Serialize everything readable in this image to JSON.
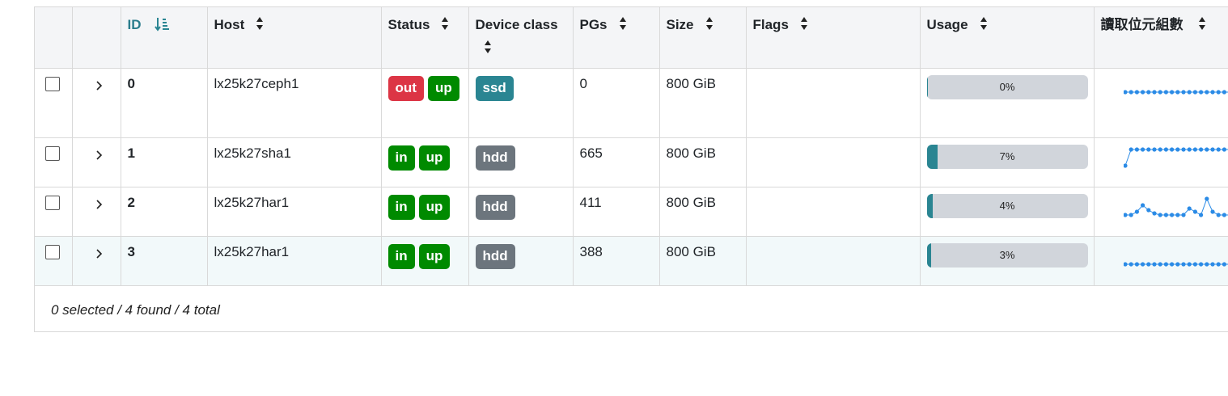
{
  "columns": {
    "id": "ID",
    "host": "Host",
    "status": "Status",
    "device_class": "Device class",
    "pgs": "PGs",
    "size": "Size",
    "flags": "Flags",
    "usage": "Usage",
    "read_bytes": "讀取位元組數"
  },
  "rows": [
    {
      "id": "0",
      "host": "lx25k27ceph1",
      "status": [
        "out",
        "up"
      ],
      "device_class": "ssd",
      "pgs": "0",
      "size": "800 GiB",
      "flags": "",
      "usage_label": "0%",
      "usage_fraction": 0.0,
      "read_bytes_trend": [
        0,
        0,
        0,
        0,
        0,
        0,
        0,
        0,
        0,
        0,
        0,
        0,
        0,
        0,
        0,
        0,
        0,
        0,
        0,
        0
      ]
    },
    {
      "id": "1",
      "host": "lx25k27sha1",
      "status": [
        "in",
        "up"
      ],
      "device_class": "hdd",
      "pgs": "665",
      "size": "800 GiB",
      "flags": "",
      "usage_label": "7%",
      "usage_fraction": 0.07,
      "read_bytes_trend": [
        0,
        1,
        1,
        1,
        1,
        1,
        1,
        1,
        1,
        1,
        1,
        1,
        1,
        1,
        1,
        1,
        1,
        1,
        1,
        1
      ]
    },
    {
      "id": "2",
      "host": "lx25k27har1",
      "status": [
        "in",
        "up"
      ],
      "device_class": "hdd",
      "pgs": "411",
      "size": "800 GiB",
      "flags": "",
      "usage_label": "4%",
      "usage_fraction": 0.04,
      "read_bytes_trend": [
        0,
        0,
        0.2,
        0.6,
        0.3,
        0.1,
        0,
        0,
        0,
        0,
        0,
        0.4,
        0.2,
        0,
        1,
        0.2,
        0,
        0,
        0,
        0
      ]
    },
    {
      "id": "3",
      "host": "lx25k27har1",
      "status": [
        "in",
        "up"
      ],
      "device_class": "hdd",
      "pgs": "388",
      "size": "800 GiB",
      "flags": "",
      "usage_label": "3%",
      "usage_fraction": 0.03,
      "read_bytes_trend": [
        0,
        0,
        0,
        0,
        0,
        0,
        0,
        0,
        0,
        0,
        0,
        0,
        0,
        0,
        0,
        0,
        0,
        0,
        0,
        0
      ]
    }
  ],
  "footer": {
    "summary": "0 selected / 4 found / 4 total"
  },
  "colors": {
    "accent": "#2a8592",
    "danger": "#dc3545",
    "success": "#008a00",
    "secondary": "#6c757d",
    "spark": "#2b8be6"
  },
  "icons": {
    "sort": "sort-icon",
    "sort_active": "sort-amount-down-icon",
    "expand": "chevron-right-icon",
    "select": "checkbox-icon"
  }
}
